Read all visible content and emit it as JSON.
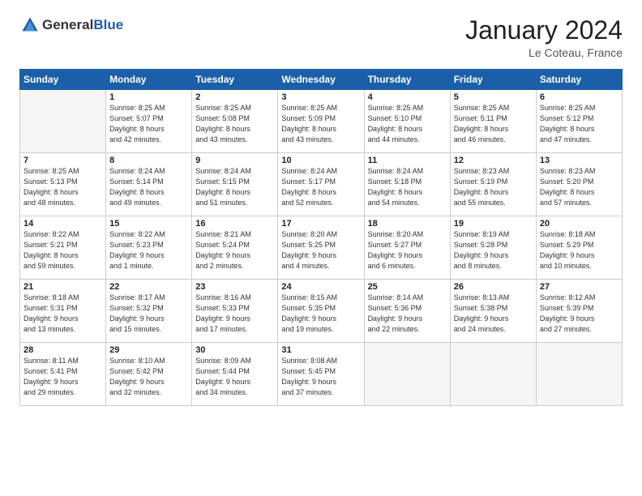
{
  "logo": {
    "general": "General",
    "blue": "Blue"
  },
  "header": {
    "month": "January 2024",
    "location": "Le Coteau, France"
  },
  "weekdays": [
    "Sunday",
    "Monday",
    "Tuesday",
    "Wednesday",
    "Thursday",
    "Friday",
    "Saturday"
  ],
  "weeks": [
    [
      {
        "day": "",
        "info": ""
      },
      {
        "day": "1",
        "info": "Sunrise: 8:25 AM\nSunset: 5:07 PM\nDaylight: 8 hours\nand 42 minutes."
      },
      {
        "day": "2",
        "info": "Sunrise: 8:25 AM\nSunset: 5:08 PM\nDaylight: 8 hours\nand 43 minutes."
      },
      {
        "day": "3",
        "info": "Sunrise: 8:25 AM\nSunset: 5:09 PM\nDaylight: 8 hours\nand 43 minutes."
      },
      {
        "day": "4",
        "info": "Sunrise: 8:25 AM\nSunset: 5:10 PM\nDaylight: 8 hours\nand 44 minutes."
      },
      {
        "day": "5",
        "info": "Sunrise: 8:25 AM\nSunset: 5:11 PM\nDaylight: 8 hours\nand 46 minutes."
      },
      {
        "day": "6",
        "info": "Sunrise: 8:25 AM\nSunset: 5:12 PM\nDaylight: 8 hours\nand 47 minutes."
      }
    ],
    [
      {
        "day": "7",
        "info": "Sunrise: 8:25 AM\nSunset: 5:13 PM\nDaylight: 8 hours\nand 48 minutes."
      },
      {
        "day": "8",
        "info": "Sunrise: 8:24 AM\nSunset: 5:14 PM\nDaylight: 8 hours\nand 49 minutes."
      },
      {
        "day": "9",
        "info": "Sunrise: 8:24 AM\nSunset: 5:15 PM\nDaylight: 8 hours\nand 51 minutes."
      },
      {
        "day": "10",
        "info": "Sunrise: 8:24 AM\nSunset: 5:17 PM\nDaylight: 8 hours\nand 52 minutes."
      },
      {
        "day": "11",
        "info": "Sunrise: 8:24 AM\nSunset: 5:18 PM\nDaylight: 8 hours\nand 54 minutes."
      },
      {
        "day": "12",
        "info": "Sunrise: 8:23 AM\nSunset: 5:19 PM\nDaylight: 8 hours\nand 55 minutes."
      },
      {
        "day": "13",
        "info": "Sunrise: 8:23 AM\nSunset: 5:20 PM\nDaylight: 8 hours\nand 57 minutes."
      }
    ],
    [
      {
        "day": "14",
        "info": "Sunrise: 8:22 AM\nSunset: 5:21 PM\nDaylight: 8 hours\nand 59 minutes."
      },
      {
        "day": "15",
        "info": "Sunrise: 8:22 AM\nSunset: 5:23 PM\nDaylight: 9 hours\nand 1 minute."
      },
      {
        "day": "16",
        "info": "Sunrise: 8:21 AM\nSunset: 5:24 PM\nDaylight: 9 hours\nand 2 minutes."
      },
      {
        "day": "17",
        "info": "Sunrise: 8:20 AM\nSunset: 5:25 PM\nDaylight: 9 hours\nand 4 minutes."
      },
      {
        "day": "18",
        "info": "Sunrise: 8:20 AM\nSunset: 5:27 PM\nDaylight: 9 hours\nand 6 minutes."
      },
      {
        "day": "19",
        "info": "Sunrise: 8:19 AM\nSunset: 5:28 PM\nDaylight: 9 hours\nand 8 minutes."
      },
      {
        "day": "20",
        "info": "Sunrise: 8:18 AM\nSunset: 5:29 PM\nDaylight: 9 hours\nand 10 minutes."
      }
    ],
    [
      {
        "day": "21",
        "info": "Sunrise: 8:18 AM\nSunset: 5:31 PM\nDaylight: 9 hours\nand 13 minutes."
      },
      {
        "day": "22",
        "info": "Sunrise: 8:17 AM\nSunset: 5:32 PM\nDaylight: 9 hours\nand 15 minutes."
      },
      {
        "day": "23",
        "info": "Sunrise: 8:16 AM\nSunset: 5:33 PM\nDaylight: 9 hours\nand 17 minutes."
      },
      {
        "day": "24",
        "info": "Sunrise: 8:15 AM\nSunset: 5:35 PM\nDaylight: 9 hours\nand 19 minutes."
      },
      {
        "day": "25",
        "info": "Sunrise: 8:14 AM\nSunset: 5:36 PM\nDaylight: 9 hours\nand 22 minutes."
      },
      {
        "day": "26",
        "info": "Sunrise: 8:13 AM\nSunset: 5:38 PM\nDaylight: 9 hours\nand 24 minutes."
      },
      {
        "day": "27",
        "info": "Sunrise: 8:12 AM\nSunset: 5:39 PM\nDaylight: 9 hours\nand 27 minutes."
      }
    ],
    [
      {
        "day": "28",
        "info": "Sunrise: 8:11 AM\nSunset: 5:41 PM\nDaylight: 9 hours\nand 29 minutes."
      },
      {
        "day": "29",
        "info": "Sunrise: 8:10 AM\nSunset: 5:42 PM\nDaylight: 9 hours\nand 32 minutes."
      },
      {
        "day": "30",
        "info": "Sunrise: 8:09 AM\nSunset: 5:44 PM\nDaylight: 9 hours\nand 34 minutes."
      },
      {
        "day": "31",
        "info": "Sunrise: 8:08 AM\nSunset: 5:45 PM\nDaylight: 9 hours\nand 37 minutes."
      },
      {
        "day": "",
        "info": ""
      },
      {
        "day": "",
        "info": ""
      },
      {
        "day": "",
        "info": ""
      }
    ]
  ]
}
